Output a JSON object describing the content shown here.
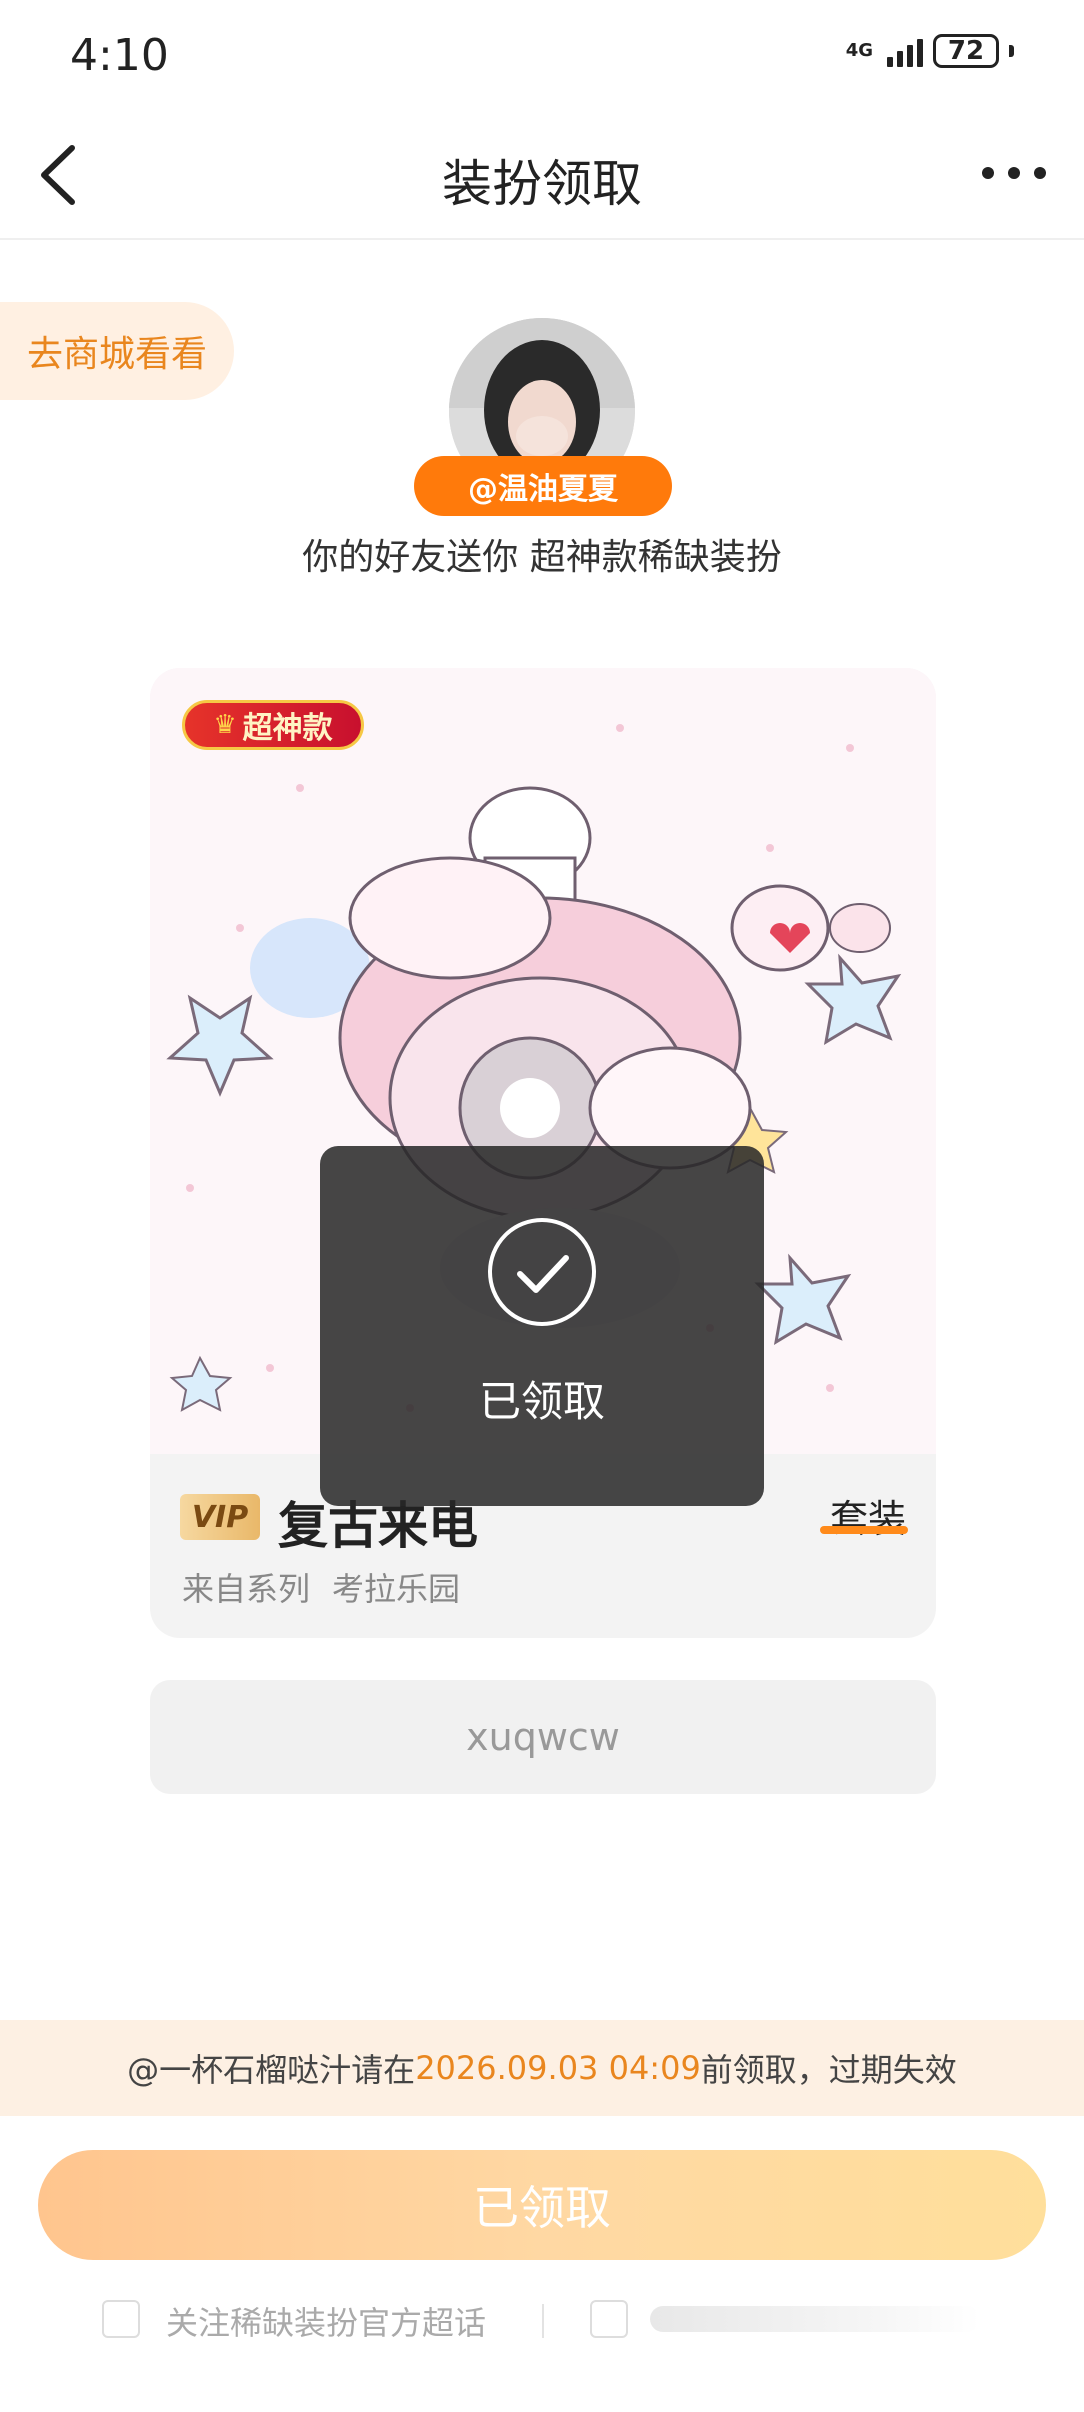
{
  "status_bar": {
    "time": "4:10",
    "network": "4G",
    "battery": "72"
  },
  "header": {
    "title": "装扮领取",
    "back_icon": "chevron-left-icon",
    "more_icon": "more-horizontal-icon"
  },
  "shop_link": "去商城看看",
  "sender": {
    "name": "@温油夏夏",
    "message": "你的好友送你 超神款稀缺装扮"
  },
  "item": {
    "rarity_tag": "超神款",
    "vip_label": "VIP",
    "name": "复古来电",
    "type": "套装",
    "series_label": "来自系列",
    "series_name": "考拉乐园",
    "code": "xuqwcw"
  },
  "toast": {
    "text": "已领取",
    "icon": "check-circle-icon"
  },
  "expiry": {
    "prefix": "@一杯石榴哒汁请在",
    "date": "2026.09.03 04:09",
    "suffix": "前领取，过期失效"
  },
  "claim_button": "已领取",
  "footer": {
    "follow_label": "关注稀缺装扮官方超话"
  },
  "colors": {
    "accent_orange": "#ff7a0b",
    "expiry_text": "#e9861e",
    "button_gradient_start": "#ffc58e",
    "button_gradient_end": "#ffdf9b"
  }
}
